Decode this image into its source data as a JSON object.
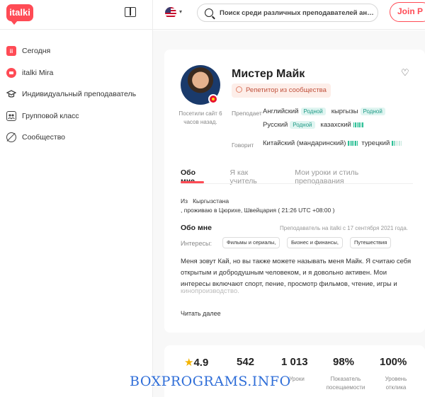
{
  "app": {
    "logo_text": "italki"
  },
  "sidebar": {
    "items": [
      {
        "label": "Сегодня",
        "icon": "today-icon"
      },
      {
        "label": "italki Mira",
        "icon": "mira-icon"
      },
      {
        "label": "Индивидуальный преподаватель",
        "icon": "graduation-cap-icon"
      },
      {
        "label": "Групповой класс",
        "icon": "group-class-icon"
      },
      {
        "label": "Сообщество",
        "icon": "community-icon"
      }
    ]
  },
  "header": {
    "search_placeholder": "Поиск среди различных преподавателей английского",
    "join_label": "Join P"
  },
  "profile": {
    "name": "Мистер Майк",
    "badge": "Репетитор из сообщества",
    "last_seen": "Посетили сайт 6 часов назад.",
    "teaches_label": "Преподает",
    "speaks_label": "Говорит",
    "native_label": "Родной",
    "teaches": [
      "Английский",
      "кыргызы",
      "Русский",
      "казахский"
    ],
    "speaks": [
      "Китайский (мандаринский)",
      "турецкий"
    ],
    "kazakh_level": 1,
    "chinese_level": 1,
    "turkish_level": 0.4
  },
  "tabs": [
    "Обо мне",
    "Я как учитель",
    "Мои уроки и стиль преподавания"
  ],
  "about": {
    "from_label": "Из",
    "country": "Кыргызстана",
    "living": ", проживаю в Цюрихе, Швейцария ( 21:26  UTC +08:00 )",
    "title": "Обо мне",
    "tutor_since": "Преподаватель на italki с 17 сентября 2021 года.",
    "interests_label": "Интересы:",
    "interests": [
      "Фильмы и сериалы,",
      "Бизнес и финансы,",
      "Путешествия"
    ],
    "bio": "Меня зовут Кай, но вы также можете называть меня Майк. Я считаю себя открытым и добродушным человеком, и я довольно активен. Мои интересы включают спорт, пение, просмотр фильмов, чтение, игры и",
    "bio_faded": "кинопроизводство.",
    "read_more": "Читать далее"
  },
  "stats": [
    {
      "value": "4.9",
      "label": ""
    },
    {
      "value": "542",
      "label": ""
    },
    {
      "value": "1 013",
      "label": "Уроки"
    },
    {
      "value": "98%",
      "label": "Показатель посещаемости"
    },
    {
      "value": "100%",
      "label": "Уровень отклика"
    }
  ],
  "watermark": "BOXPROGRAMS.INFO",
  "colors": {
    "brand": "#ff4b55",
    "native_bg": "#e0f5f1",
    "native_text": "#1f9a86",
    "badge_bg": "#fdeee9"
  }
}
